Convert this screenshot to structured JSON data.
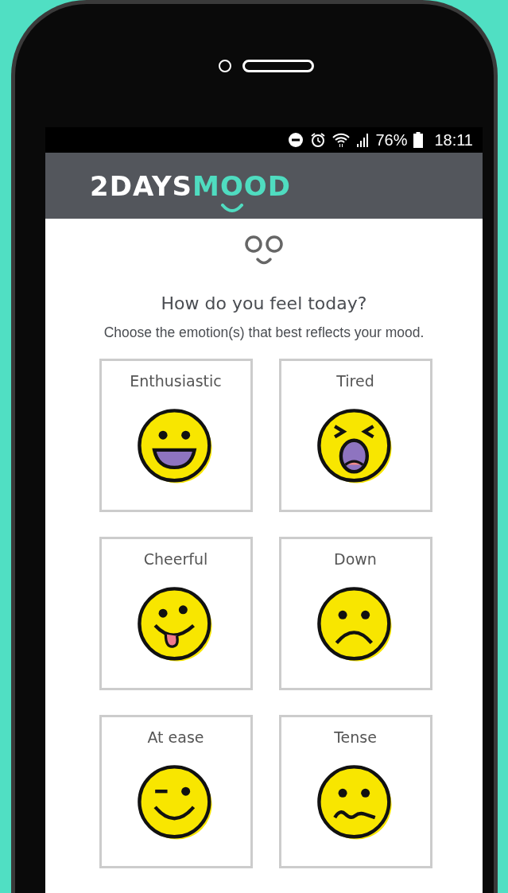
{
  "status_bar": {
    "battery": "76%",
    "time": "18:11"
  },
  "header": {
    "logo_lead": "2DAYS",
    "logo_accent": "MOOD"
  },
  "question": "How do you feel today?",
  "instruction": "Choose the emotion(s) that best reflects your mood.",
  "emotions": [
    {
      "label": "Enthusiastic",
      "kind": "grin"
    },
    {
      "label": "Tired",
      "kind": "yawn"
    },
    {
      "label": "Cheerful",
      "kind": "tongue"
    },
    {
      "label": "Down",
      "kind": "frown"
    },
    {
      "label": "At ease",
      "kind": "wink"
    },
    {
      "label": "Tense",
      "kind": "wavy"
    }
  ]
}
